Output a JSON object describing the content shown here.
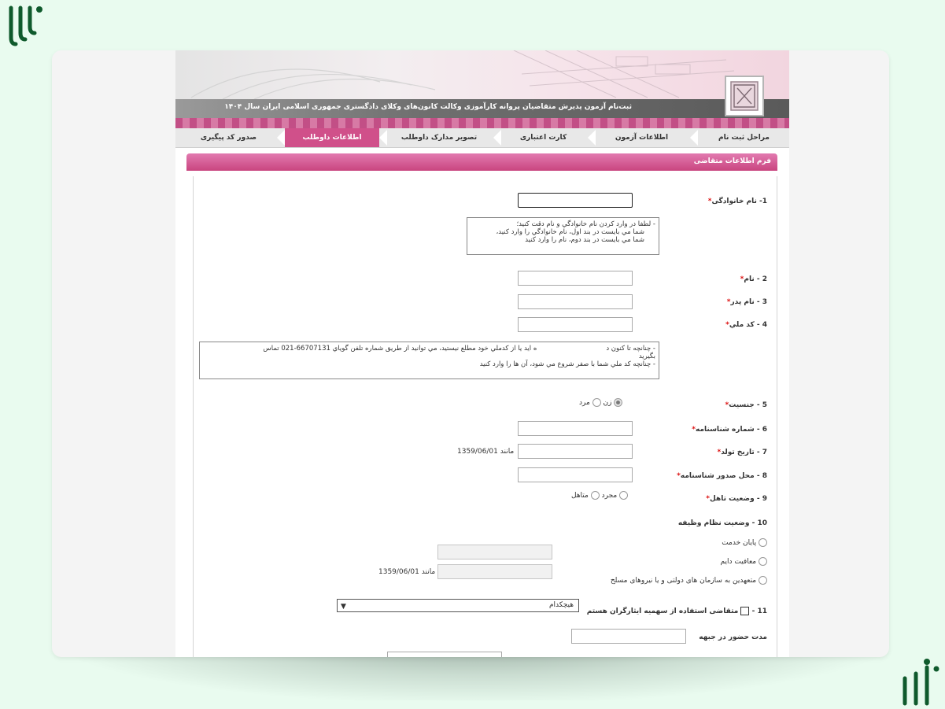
{
  "banner": {
    "title": "ثبت‌نام آزمون پذیرش متقاضیان پروانه کارآموزی وکالت کانون‌های وکلای دادگستری جمهوری اسلامی ایران سال ۱۴۰۴"
  },
  "nav": {
    "items": [
      {
        "label": "مراحل ثبت نام"
      },
      {
        "label": "اطلاعات آزمون"
      },
      {
        "label": "کارت اعتباری"
      },
      {
        "label": "تصویر مدارک داوطلب"
      },
      {
        "label": "اطلاعات داوطلب"
      },
      {
        "label": "صدور کد پیگیری"
      }
    ],
    "active": "اطلاعات داوطلب"
  },
  "form": {
    "header": "فرم اطلاعات متقاضی",
    "required_mark": "*",
    "family": {
      "label": "1- نام خانوادگی",
      "value": ""
    },
    "family_note": [
      "- لطفا در وارد کردن نام خانوادگي و نام دقت کنيد؛",
      "شما مي بايست در بند اول، نام خانوادگي را وارد کنيد،",
      "شما مي بايست در بند دوم، نام را وارد کنيد"
    ],
    "name": {
      "label": "2 - نام",
      "value": ""
    },
    "father": {
      "label": "3 - نام پدر",
      "value": ""
    },
    "national_code": {
      "label": "4 - کد ملي",
      "value": ""
    },
    "code_note": [
      "- چنانچه تا کنون د",
      "ه ايد يا از کدملي خود مطلع نيستيد، مي توانيد از طريق شماره تلفن گوياي 66707131-021 تماس",
      "بگيريد",
      "- چنانچه کد ملي شما با صفر شروع مي شود، آن ها را وارد کنيد"
    ],
    "gender": {
      "label": "5 - جنسیت",
      "options": [
        "زن",
        "مرد"
      ],
      "selected": "زن"
    },
    "id_number": {
      "label": "6 - شماره شناسنامه",
      "value": ""
    },
    "birth_date": {
      "label": "7 - تاریخ تولد",
      "value": "",
      "hint": "1359/06/01",
      "hint_prefix": "مانند"
    },
    "id_place": {
      "label": "8 - محل صدور شناسنامه",
      "value": ""
    },
    "marital": {
      "label": "9 - وضعیت تاهل",
      "options": [
        "مجرد",
        "متاهل"
      ]
    },
    "military": {
      "label": "10 - وضعیت نظام وظیفه",
      "options": [
        "پایان خدمت",
        "معافیت دایم",
        "متعهدین به سازمان های دولتی و یا نیروهای مسلح"
      ],
      "hint": "1359/06/01",
      "hint_prefix": "مانند"
    },
    "sacrifice": {
      "label": "11 - ",
      "checkbox_label": "متقاضی استفاده از سهمیه  ایثارگران هستم",
      "select_value": "هیچکدام"
    },
    "front_duration": {
      "label": "مدت حضور در جبهه",
      "value": ""
    }
  }
}
